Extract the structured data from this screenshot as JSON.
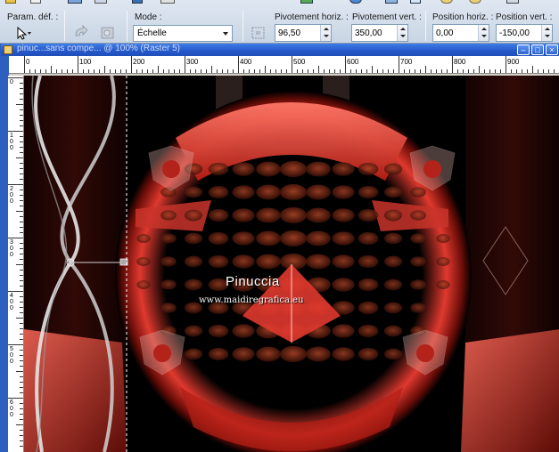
{
  "toolbar": {
    "preset_label": "Param. déf. :",
    "mode_label": "Mode :",
    "mode_value": "Échelle",
    "pivot_h_label": "Pivotement horiz. :",
    "pivot_h_value": "96,50",
    "pivot_v_label": "Pivotement vert. :",
    "pivot_v_value": "350,00",
    "pos_h_label": "Position horiz. :",
    "pos_h_value": "0,00",
    "pos_v_label": "Position vert. :",
    "pos_v_value": "-150,00"
  },
  "document": {
    "title": "pinuc...sans compe... @ 100% (Raster 5)"
  },
  "ruler": {
    "h_labels": [
      "0",
      "100",
      "200",
      "300",
      "400",
      "500",
      "600",
      "700",
      "800",
      "900"
    ],
    "v_labels": [
      "0",
      "100",
      "200",
      "300",
      "400",
      "500",
      "600"
    ]
  },
  "watermark": {
    "title": "Pinuccia",
    "url": "www.maidiregrafica.eu"
  },
  "colors": {
    "accent_red": "#e0392e",
    "title_bar": "#2558c9",
    "toolbar_bg": "#d6dfeb"
  }
}
